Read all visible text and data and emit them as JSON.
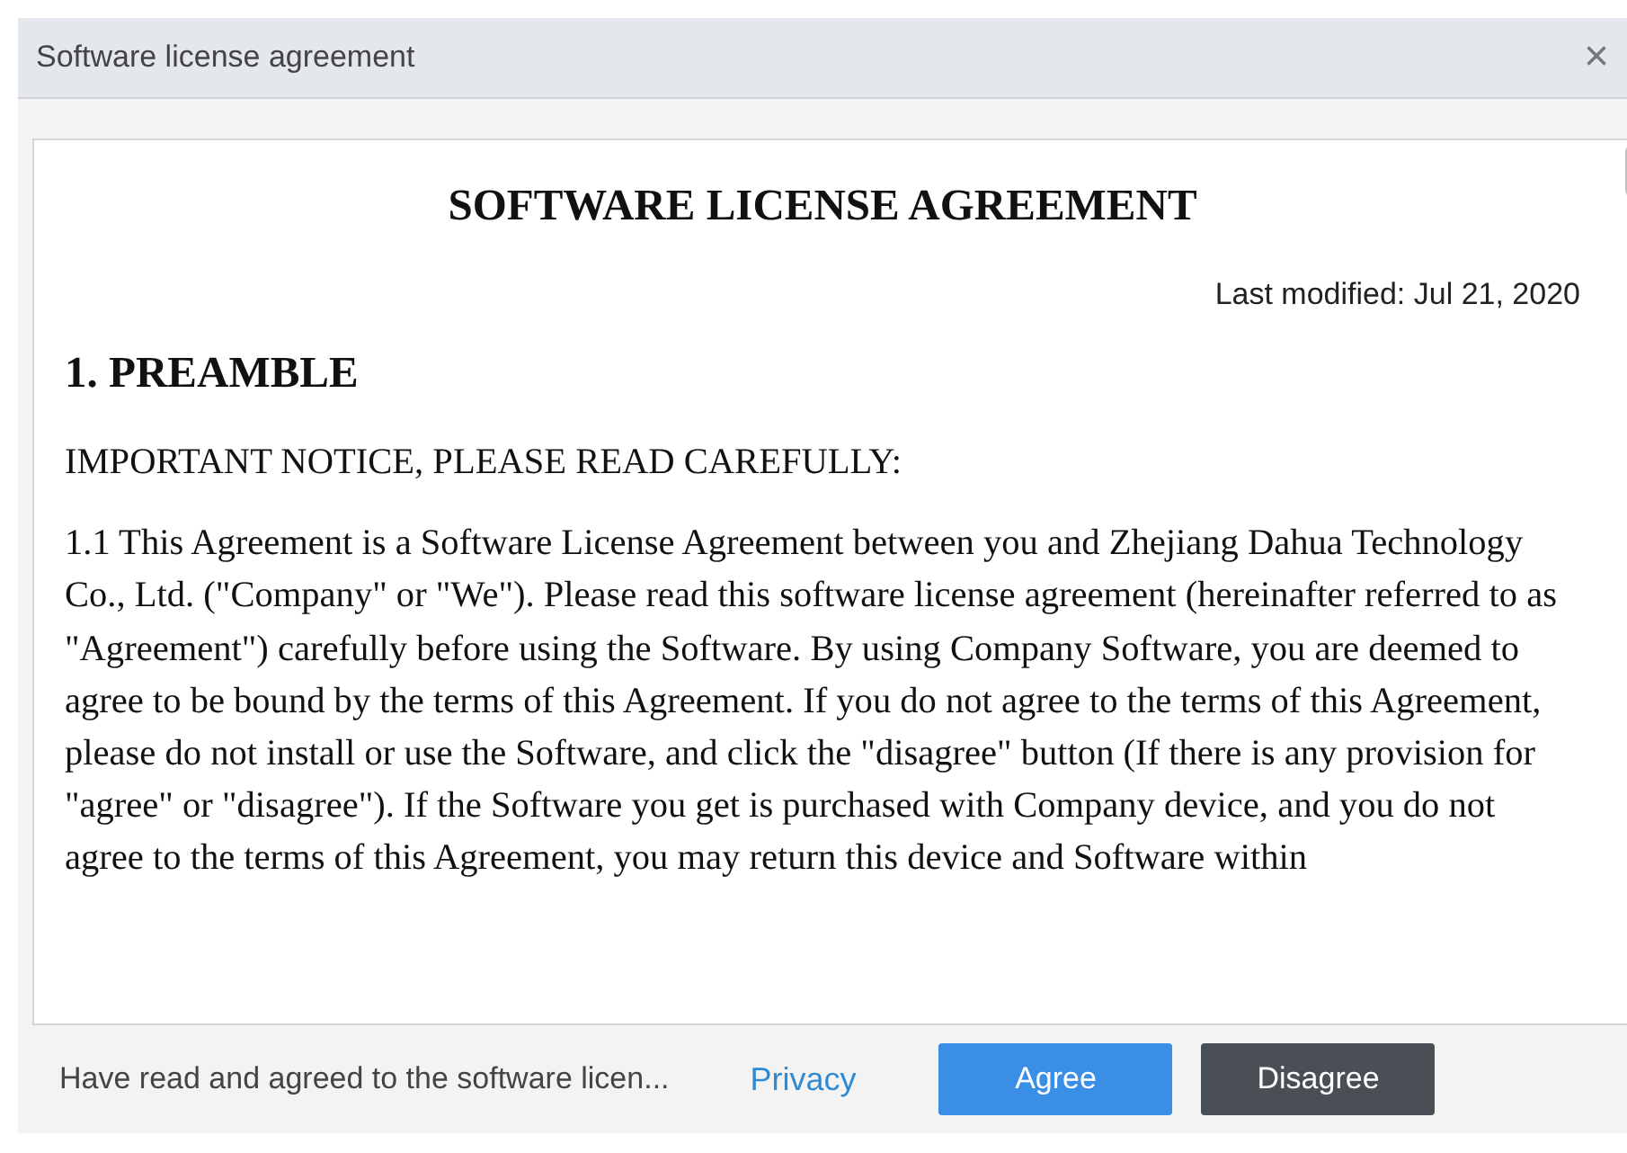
{
  "window": {
    "title": "Software license agreement",
    "close": "×"
  },
  "document": {
    "title": "SOFTWARE LICENSE AGREEMENT",
    "modified": "Last modified: Jul 21, 2020",
    "blocks": [
      {
        "kind": "heading",
        "text": "1. PREAMBLE"
      },
      {
        "kind": "paragraph",
        "text": "IMPORTANT NOTICE, PLEASE READ CAREFULLY:"
      },
      {
        "kind": "paragraph",
        "text": "1.1 This Agreement is a Software License Agreement between you and Zhejiang Dahua Technology Co., Ltd. (\"Company\" or \"We\"). Please read this software license agreement (hereinafter referred to as \"Agreement\") carefully before using the Software. By using Company Software, you are deemed to agree to be bound by the terms of this Agreement. If you do not agree to the terms of this Agreement, please do not install or use the Software, and click the \"disagree\" button (If there is any provision for \"agree\" or \"disagree\"). If the Software you get is purchased with Company device, and you do not agree to the terms of this Agreement, you may return this device and Software within"
      }
    ]
  },
  "footer": {
    "note": "Have read and agreed to the software licen...",
    "link": "Privacy",
    "buttons": [
      {
        "label": "Agree",
        "kind": "primary"
      },
      {
        "label": "Disagree",
        "kind": "secondary"
      }
    ]
  }
}
